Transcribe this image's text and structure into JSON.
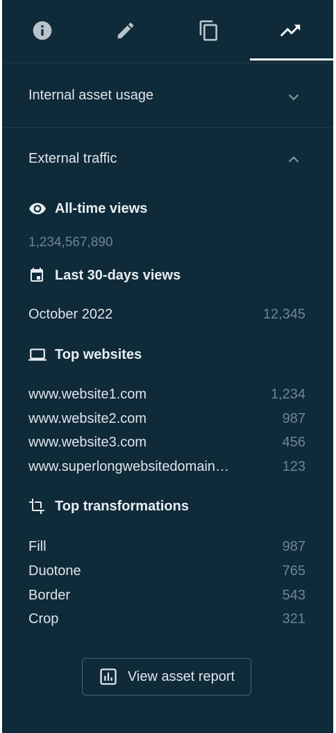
{
  "tabs": [
    {
      "icon": "info-icon"
    },
    {
      "icon": "edit-icon"
    },
    {
      "icon": "copy-icon"
    },
    {
      "icon": "trending-up-icon",
      "active": true
    }
  ],
  "internal": {
    "label": "Internal asset usage",
    "expanded": false
  },
  "external": {
    "label": "External traffic",
    "expanded": true,
    "all_time": {
      "title": "All-time views",
      "value": "1,234,567,890"
    },
    "last30": {
      "title": "Last 30-days views",
      "rows": [
        {
          "name": "October 2022",
          "value": "12,345"
        }
      ]
    },
    "websites": {
      "title": "Top websites",
      "rows": [
        {
          "name": "www.website1.com",
          "value": "1,234"
        },
        {
          "name": "www.website2.com",
          "value": "987"
        },
        {
          "name": "www.website3.com",
          "value": "456"
        },
        {
          "name": "www.superlongwebsitedomain…",
          "value": "123"
        }
      ]
    },
    "transformations": {
      "title": "Top transformations",
      "rows": [
        {
          "name": "Fill",
          "value": "987"
        },
        {
          "name": "Duotone",
          "value": "765"
        },
        {
          "name": "Border",
          "value": "543"
        },
        {
          "name": "Crop",
          "value": "321"
        }
      ]
    }
  },
  "report_button": {
    "label": "View asset report",
    "icon": "bar-chart-icon"
  }
}
